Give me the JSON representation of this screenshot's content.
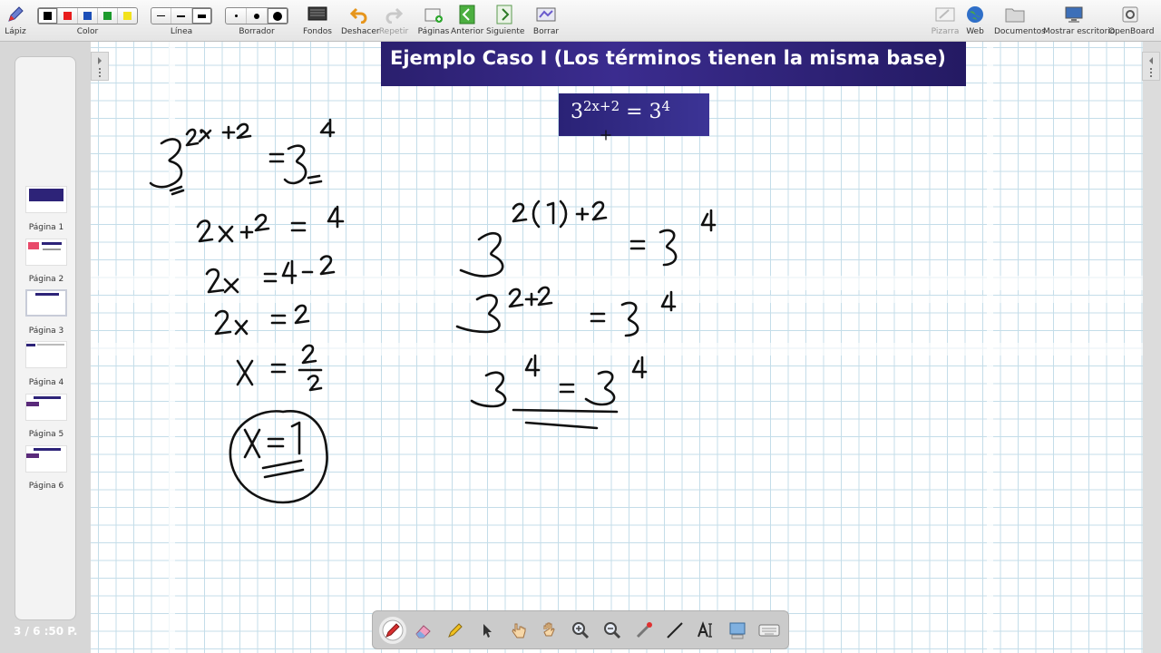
{
  "toolbar": {
    "items": [
      {
        "label": "Lápiz",
        "icon": "pen-icon"
      },
      {
        "label": "Color",
        "icon": "color-swatches"
      },
      {
        "label": "Línea",
        "icon": "line-width"
      },
      {
        "label": "Borrador",
        "icon": "eraser-size"
      },
      {
        "label": "Fondos",
        "icon": "background-icon"
      },
      {
        "label": "Deshacer",
        "icon": "undo-icon"
      },
      {
        "label": "Repetir",
        "icon": "redo-icon"
      },
      {
        "label": "Páginas",
        "icon": "pages-icon"
      },
      {
        "label": "Anterior",
        "icon": "previous-icon"
      },
      {
        "label": "Siguiente",
        "icon": "next-icon"
      },
      {
        "label": "Borrar",
        "icon": "clear-icon"
      },
      {
        "label": "Pizarra",
        "icon": "board-icon"
      },
      {
        "label": "Web",
        "icon": "globe-icon"
      },
      {
        "label": "Documentos",
        "icon": "folder-icon"
      },
      {
        "label": "Mostrar escritorio",
        "icon": "desktop-icon"
      },
      {
        "label": "OpenBoard",
        "icon": "settings-icon"
      }
    ],
    "colors": [
      "#000000",
      "#e81c1c",
      "#1c4fb8",
      "#1c9a2c",
      "#f2e21c"
    ]
  },
  "sidebar": {
    "pages": [
      "Página 1",
      "Página 2",
      "Página 3",
      "Página 4",
      "Página 5",
      "Página 6"
    ],
    "page_counter": "3 / 6 :50 P."
  },
  "board": {
    "title": "Ejemplo Caso I (Los términos tienen la misma base)",
    "equation": {
      "base": "3",
      "exponent": "2x+2",
      "rhs_base": "3",
      "rhs_exponent": "4"
    }
  },
  "palette": {
    "tools": [
      "pen-tool-icon",
      "eraser-tool-icon",
      "highlighter-icon",
      "pointer-icon",
      "interact-hand-icon",
      "pan-hand-icon",
      "zoom-in-icon",
      "zoom-out-icon",
      "laser-pointer-icon",
      "line-tool-icon",
      "text-tool-icon",
      "capture-icon",
      "keyboard-icon"
    ]
  },
  "colors": {
    "accent": "#2a1f6e",
    "grid": "#c4dde9",
    "ink": "#111111"
  }
}
